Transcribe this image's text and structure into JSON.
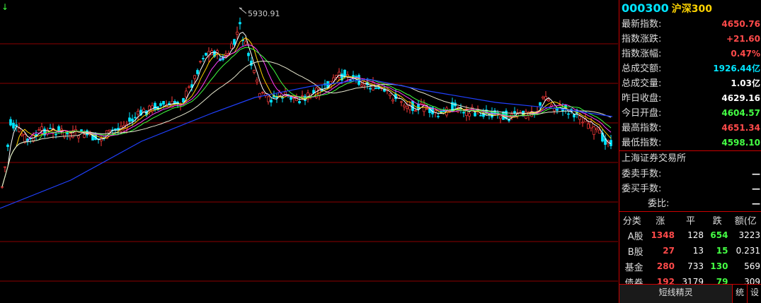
{
  "chart": {
    "peak_label": "5930.91",
    "arrow_glyph": "↓",
    "colors": {
      "up": "#ff3b3b",
      "down": "#00e5ff",
      "ma5": "#ffffff",
      "ma10": "#ffd400",
      "ma20": "#ff40ff",
      "ma30": "#40ff40",
      "ma60": "#e8e8d0",
      "ma120": "#2040ff",
      "grid": "#8b0000"
    }
  },
  "panel": {
    "code": "000300",
    "name": "沪深300",
    "quotes": [
      {
        "label": "最新指数:",
        "value": "4650.76",
        "tone": "red"
      },
      {
        "label": "指数涨跌:",
        "value": "+21.60",
        "tone": "red"
      },
      {
        "label": "指数涨幅:",
        "value": "0.47%",
        "tone": "red"
      },
      {
        "label": "总成交额:",
        "value": "1926.44亿",
        "tone": "cyan"
      },
      {
        "label": "总成交量:",
        "value": "1.03亿",
        "tone": "white"
      },
      {
        "label": "昨日收盘:",
        "value": "4629.16",
        "tone": "white"
      },
      {
        "label": "今日开盘:",
        "value": "4604.57",
        "tone": "green"
      },
      {
        "label": "最高指数:",
        "value": "4651.34",
        "tone": "red"
      },
      {
        "label": "最低指数:",
        "value": "4598.10",
        "tone": "green"
      }
    ],
    "exchange": "上海证券交易所",
    "orders": [
      {
        "label": "委卖手数:",
        "value": "—"
      },
      {
        "label": "委买手数:",
        "value": "—"
      },
      {
        "label": "委比:",
        "value": "—"
      }
    ],
    "table": {
      "headers": [
        "分类",
        "涨",
        "平",
        "跌",
        "额(亿"
      ],
      "rows": [
        {
          "name": "A股",
          "up": "1348",
          "flat": "128",
          "down": "654",
          "amount": "3223"
        },
        {
          "name": "B股",
          "up": "27",
          "flat": "13",
          "down": "15",
          "amount": "0.231"
        },
        {
          "name": "基金",
          "up": "280",
          "flat": "733",
          "down": "130",
          "amount": "569"
        },
        {
          "name": "债券",
          "up": "192",
          "flat": "3179",
          "down": "79",
          "amount": "309"
        }
      ]
    },
    "bottom": {
      "title": "短线精灵",
      "btn1": "统",
      "btn2": "设"
    }
  }
}
